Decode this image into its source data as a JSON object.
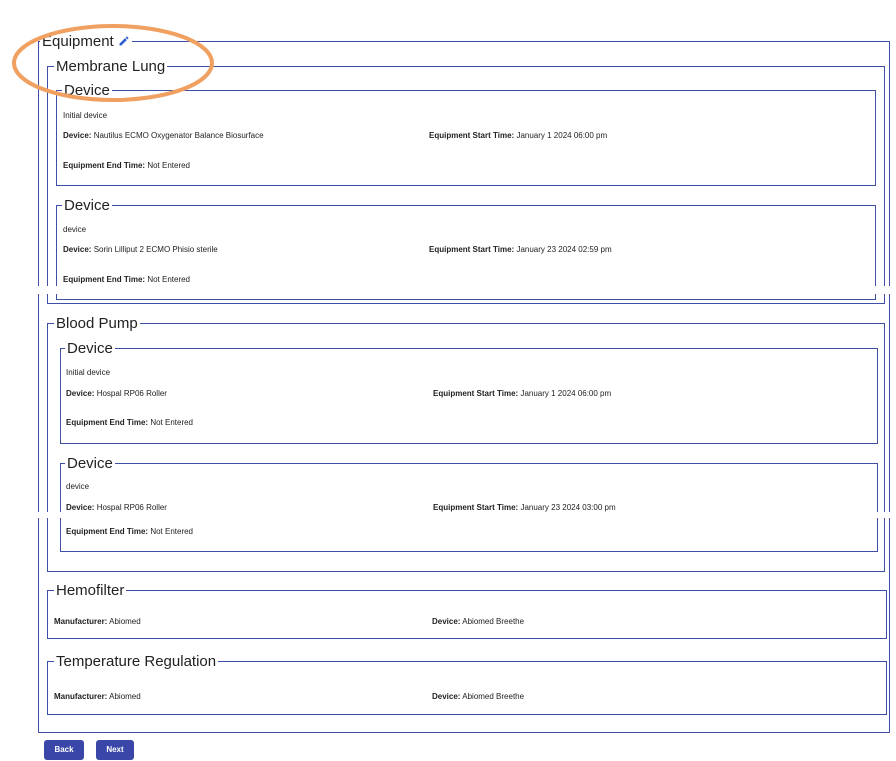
{
  "equipment": {
    "title": "Equipment"
  },
  "membrane_lung": {
    "title": "Membrane Lung",
    "devices": [
      {
        "title": "Device",
        "note": "Initial device",
        "device_label": "Device:",
        "device_value": "Nautilus ECMO Oxygenator Balance Biosurface",
        "start_label": "Equipment Start Time:",
        "start_value": "January 1 2024 06:00 pm",
        "end_label": "Equipment End Time:",
        "end_value": "Not Entered"
      },
      {
        "title": "Device",
        "note": "device",
        "device_label": "Device:",
        "device_value": "Sorin Lilliput 2 ECMO Phisio sterile",
        "start_label": "Equipment Start Time:",
        "start_value": "January 23 2024 02:59 pm",
        "end_label": "Equipment End Time:",
        "end_value": "Not Entered"
      }
    ]
  },
  "blood_pump": {
    "title": "Blood Pump",
    "devices": [
      {
        "title": "Device",
        "note": "Initial device",
        "device_label": "Device:",
        "device_value": "Hospal RP06 Roller",
        "start_label": "Equipment Start Time:",
        "start_value": "January 1 2024 06:00 pm",
        "end_label": "Equipment End Time:",
        "end_value": "Not Entered"
      },
      {
        "title": "Device",
        "note": "device",
        "device_label": "Device:",
        "device_value": "Hospal RP06 Roller",
        "start_label": "Equipment Start Time:",
        "start_value": "January 23 2024 03:00 pm",
        "end_label": "Equipment End Time:",
        "end_value": "Not Entered"
      }
    ]
  },
  "hemofilter": {
    "title": "Hemofilter",
    "manufacturer_label": "Manufacturer:",
    "manufacturer_value": "Abiomed",
    "device_label": "Device:",
    "device_value": "Abiomed Breethe"
  },
  "temperature_regulation": {
    "title": "Temperature Regulation",
    "manufacturer_label": "Manufacturer:",
    "manufacturer_value": "Abiomed",
    "device_label": "Device:",
    "device_value": "Abiomed Breethe"
  },
  "buttons": {
    "back": "Back",
    "next": "Next"
  },
  "colors": {
    "border": "#3f4fa8",
    "button": "#3b47a8",
    "highlight_ellipse": "#f0a060",
    "pencil": "#2f5fd0"
  },
  "icons": {
    "edit": "pencil-icon"
  }
}
